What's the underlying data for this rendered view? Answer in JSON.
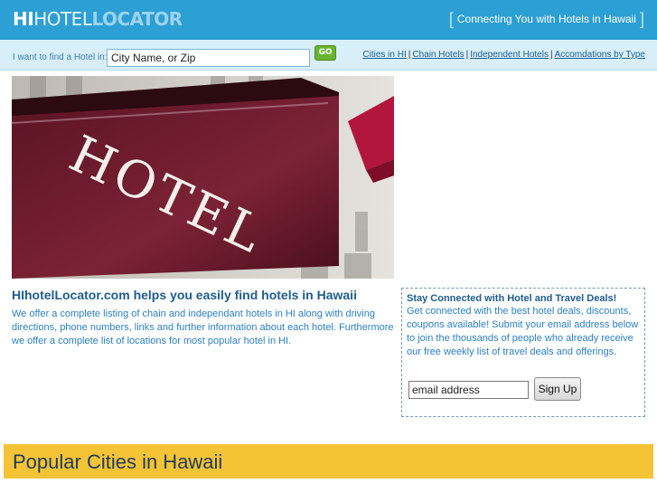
{
  "header": {
    "logo": {
      "part1": "HI",
      "part2": "HOTEL",
      "part3": "LOCATOR"
    },
    "tagline": "Connecting You with Hotels in Hawaii"
  },
  "search": {
    "label": "I want to find a Hotel in:",
    "value": "City Name, or Zip",
    "go_label": "GO"
  },
  "nav": {
    "links": [
      "Cities in HI",
      "Chain Hotels",
      "Independent Hotels",
      "Accomdations by Type"
    ]
  },
  "hero": {
    "sign_text": "HOTEL"
  },
  "main": {
    "title": "HIhotelLocator.com helps you easily find hotels in Hawaii",
    "text": "We offer a complete listing of chain and independant hotels in HI along with driving directions, phone numbers, links and further information about each hotel. Furthermore we offer a complete list of locations for most popular hotel in HI."
  },
  "signup": {
    "title": "Stay Connected with Hotel and Travel Deals!",
    "text": "Get connected with the best hotel deals, discounts, coupons available! Submit your email address below to join the thousands of people who already receive our free weekly list of travel deals and offerings.",
    "email_value": "email address",
    "button_label": "Sign Up"
  },
  "popular": {
    "title": "Popular Cities in Hawaii"
  }
}
